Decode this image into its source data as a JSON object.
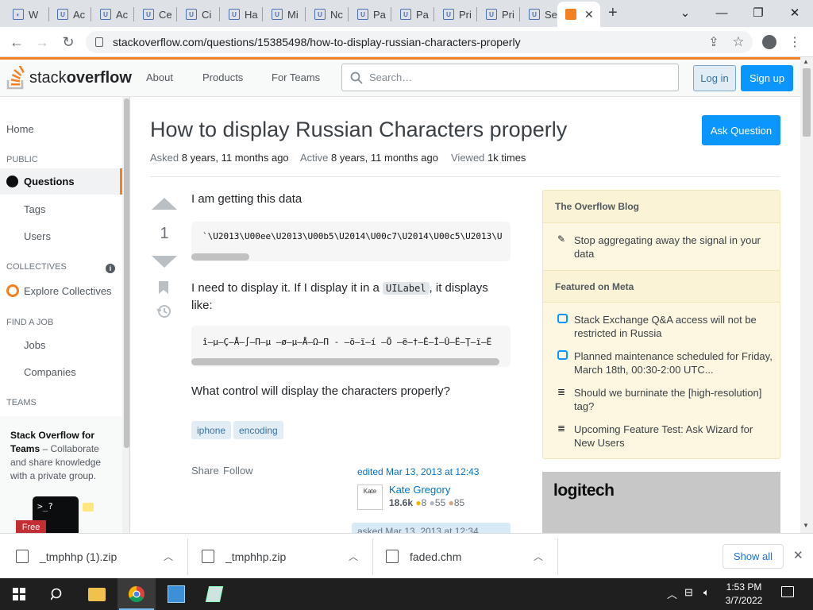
{
  "browser": {
    "tabs": [
      {
        "label": "W"
      },
      {
        "label": "Ac"
      },
      {
        "label": "Ac"
      },
      {
        "label": "Ce"
      },
      {
        "label": "Ci"
      },
      {
        "label": "Ha"
      },
      {
        "label": "Mi"
      },
      {
        "label": "Nc"
      },
      {
        "label": "Pa"
      },
      {
        "label": "Pa"
      },
      {
        "label": "Pri"
      },
      {
        "label": "Pri"
      },
      {
        "label": "Se"
      }
    ],
    "new_tab": "+",
    "url": "stackoverflow.com/questions/15385498/how-to-display-russian-characters-properly"
  },
  "so_header": {
    "logo_light": "stack",
    "logo_bold": "overflow",
    "nav": [
      "About",
      "Products",
      "For Teams"
    ],
    "search_placeholder": "Search…",
    "login": "Log in",
    "signup": "Sign up"
  },
  "leftnav": {
    "home": "Home",
    "public": "PUBLIC",
    "questions": "Questions",
    "tags": "Tags",
    "users": "Users",
    "collectives": "COLLECTIVES",
    "explore": "Explore Collectives",
    "find_job": "FIND A JOB",
    "jobs": "Jobs",
    "companies": "Companies",
    "teams": "TEAMS",
    "teams_title": "Stack Overflow for Teams",
    "teams_rest": " – Collaborate and share knowledge with a private group.",
    "free": "Free"
  },
  "question": {
    "title": "How to display Russian Characters properly",
    "ask_button": "Ask Question",
    "asked_label": "Asked",
    "asked_value": "8 years, 11 months ago",
    "active_label": "Active",
    "active_value": "8 years, 11 months ago",
    "viewed_label": "Viewed",
    "viewed_value": "1k times",
    "score": "1",
    "p1": "I am getting this data",
    "code1": "`\\U2013\\U00ee\\U2013\\U00b5\\U2014\\U00c7\\U2014\\U00c5\\U2013\\U",
    "p2_a": "I need to display it. If I display it in a ",
    "p2_code": "UILabel",
    "p2_b": ", it displays like:",
    "code2": "î–µ–Ç–Å–∫–Π–µ –ø–µ–Å–Ω–Π - –õ–ï–í –Õ –ë–†–Ê–Î–Û–Ë–Ţ–ï–Ë",
    "p3": "What control will display the characters properly?",
    "tags": [
      "iphone",
      "encoding"
    ],
    "share": "Share",
    "follow": "Follow",
    "edited": "edited Mar 13, 2013 at 12:43",
    "editor_name": "Kate Gregory",
    "editor_rep": "18.6k",
    "editor_gold": "8",
    "editor_silver": "55",
    "editor_bronze": "85",
    "asked_card": "asked Mar 13, 2013 at 12:34"
  },
  "sidebar": {
    "blog_head": "The Overflow Blog",
    "blog_items": [
      "Stop aggregating away the signal in your data"
    ],
    "meta_head": "Featured on Meta",
    "meta_items": [
      "Stack Exchange Q&A access will not be restricted in Russia",
      "Planned maintenance scheduled for Friday, March 18th, 00:30-2:00 UTC...",
      "Should we burninate the [high-resolution] tag?",
      "Upcoming Feature Test: Ask Wizard for New Users"
    ],
    "ad_brand": "logitech"
  },
  "downloads": {
    "items": [
      "_tmphhp (1).zip",
      "_tmphhp.zip",
      "faded.chm"
    ],
    "show_all": "Show all"
  },
  "taskbar": {
    "time": "1:53 PM",
    "date": "3/7/2022"
  },
  "colors": {
    "so_orange": "#f48024",
    "so_blue": "#0a95ff",
    "tag_bg": "#e1ecf4",
    "blog_bg": "#fdf7e2"
  }
}
